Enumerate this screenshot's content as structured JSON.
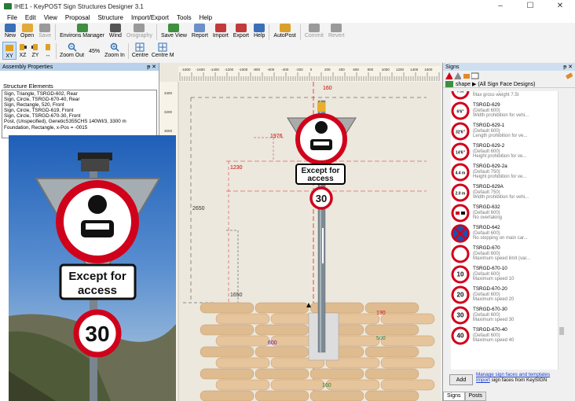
{
  "window": {
    "title": "IHE1 - KeyPOST Sign Structures Designer 3.1",
    "min": "–",
    "max": "☐",
    "close": "✕"
  },
  "menu": [
    "File",
    "Edit",
    "View",
    "Proposal",
    "Structure",
    "Import/Export",
    "Tools",
    "Help"
  ],
  "toolbar": [
    {
      "label": "New",
      "icon": "new-document-icon",
      "color": "#3b6fb6",
      "enabled": true
    },
    {
      "label": "Open",
      "icon": "open-folder-icon",
      "color": "#e2a93b",
      "enabled": true
    },
    {
      "label": "Save",
      "icon": "save-icon",
      "color": "#9a9a9a",
      "enabled": false
    },
    {
      "label": "Environs Manager",
      "icon": "tree-icon",
      "color": "#3f8f3f",
      "enabled": true
    },
    {
      "label": "Wind",
      "icon": "wind-icon",
      "color": "#555555",
      "enabled": true
    },
    {
      "label": "Orography",
      "icon": "mountain-icon",
      "color": "#9a9a9a",
      "enabled": false
    },
    {
      "label": "Save View",
      "icon": "save-view-icon",
      "color": "#3f8f3f",
      "enabled": true
    },
    {
      "label": "Report",
      "icon": "report-icon",
      "color": "#6b8fc8",
      "enabled": true
    },
    {
      "label": "Import",
      "icon": "import-icon",
      "color": "#c33a3a",
      "enabled": true
    },
    {
      "label": "Export",
      "icon": "export-icon",
      "color": "#c33a3a",
      "enabled": true
    },
    {
      "label": "Help",
      "icon": "help-icon",
      "color": "#3b6fb6",
      "enabled": true
    },
    {
      "label": "AutoPost",
      "icon": "autopost-icon",
      "color": "#d9a12b",
      "enabled": true
    },
    {
      "label": "Commit",
      "icon": "commit-icon",
      "color": "#9a9a9a",
      "enabled": false
    },
    {
      "label": "Revert",
      "icon": "revert-icon",
      "color": "#9a9a9a",
      "enabled": false
    }
  ],
  "view_toolbar": {
    "views": [
      "XY",
      "XZ",
      "ZY",
      "↔"
    ],
    "zoom_out": "Zoom Out",
    "zoom_level": "45%",
    "zoom_in": "Zoom In",
    "centre": "Centre",
    "centre_m": "Centre M"
  },
  "assembly": {
    "header": "Assembly Properties",
    "pin": "ᵽ",
    "close": "✕",
    "structure_label": "Structure Elements",
    "elements": [
      "Sign, Triangle, TSRGD-602, Rear",
      "Sign, Circle, TSRGD-670-40, Rear",
      "Sign, Rectangle, 520, Front",
      "Sign, Circle, TSRGD-619, Front",
      "Sign, Circle, TSRGD-670-30, Front",
      "Post, (Unspecified), GeneticS355CHS 140Wl/3, 3300 m",
      "Foundation, Rectangle, x-Pos = -0015"
    ]
  },
  "canvas": {
    "ruler_ticks": [
      "-1800",
      "-1600",
      "-1400",
      "-1200",
      "-1000",
      "-800",
      "-600",
      "-400",
      "-200",
      "0",
      "200",
      "400",
      "600",
      "800",
      "1000",
      "1200",
      "1400",
      "1600"
    ],
    "side_ticks": [
      "3400",
      "3200",
      "3000",
      "2800"
    ],
    "dims": {
      "d160top": "160",
      "d1976": "1976",
      "d1230": "1230",
      "d2650": "2650",
      "d1650": "1650",
      "d130": "130",
      "d600": "600",
      "d500": "500",
      "d160bot": "160"
    },
    "sign_text": [
      "Except for",
      "access"
    ],
    "speed": "30"
  },
  "photo": {
    "sign_text": [
      "Except for",
      "access"
    ],
    "speed": "30"
  },
  "signs_panel": {
    "header": "Signs",
    "pin": "ᵽ",
    "close": "✕",
    "breadcrumb": "shape ▶ (All Sign Face Designs)",
    "items": [
      {
        "code": "TSRGD-626-275",
        "default": "(Default 600)",
        "desc": "Max gross weight 7.5t",
        "thumb": "7.5t"
      },
      {
        "code": "TSRGD-629",
        "default": "(Default 600)",
        "desc": "Width prohibition for vehi...",
        "thumb": "6'6\""
      },
      {
        "code": "TSRGD-629-1",
        "default": "(Default 600)",
        "desc": "Length prohibition for ve...",
        "thumb": "32'6\""
      },
      {
        "code": "TSRGD-629-2",
        "default": "(Default 600)",
        "desc": "Height prohibition for ve...",
        "thumb": "14'6\""
      },
      {
        "code": "TSRGD-629-2a",
        "default": "(Default 750)",
        "desc": "Height prohibition for ve...",
        "thumb": "4.4 m"
      },
      {
        "code": "TSRGD-629A",
        "default": "(Default 750)",
        "desc": "Width prohibition for vehi...",
        "thumb": "2.0 m"
      },
      {
        "code": "TSRGD-632",
        "default": "(Default 600)",
        "desc": "No overtaking",
        "thumb": ""
      },
      {
        "code": "TSRGD-642",
        "default": "(Default 600)",
        "desc": "No stopping on main car...",
        "thumb": ""
      },
      {
        "code": "TSRGD-670",
        "default": "(Default 600)",
        "desc": "Maximum speed limit (var...",
        "thumb": ""
      },
      {
        "code": "TSRGD-670-10",
        "default": "(Default 600)",
        "desc": "Maximum speed 10",
        "thumb": "10"
      },
      {
        "code": "TSRGD-670-20",
        "default": "(Default 600)",
        "desc": "Maximum speed 20",
        "thumb": "20"
      },
      {
        "code": "TSRGD-670-30",
        "default": "(Default 600)",
        "desc": "Maximum speed 30",
        "thumb": "30"
      },
      {
        "code": "TSRGD-670-40",
        "default": "(Default 600)",
        "desc": "Maximum speed 40",
        "thumb": "40"
      }
    ],
    "add": "Add",
    "link1": "Manage sign faces and templates",
    "link2_a": "Import",
    "link2_b": " sign faces from KeySIGN",
    "tabs": [
      "Signs",
      "Posts"
    ]
  }
}
